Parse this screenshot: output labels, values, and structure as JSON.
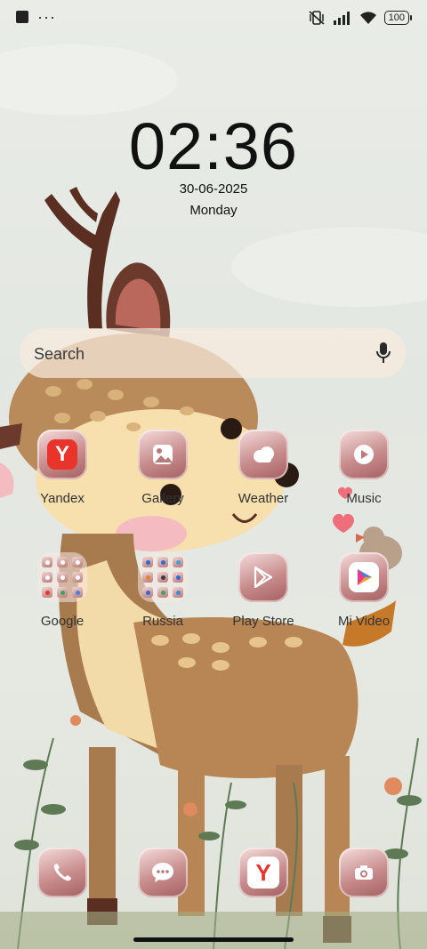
{
  "status_bar": {
    "notification_icon": "square-notification-icon",
    "overflow_text": "···",
    "icons": [
      "vibrate-off-icon",
      "signal-icon",
      "wifi-icon"
    ],
    "battery": "100"
  },
  "lock_clock": {
    "time": "02:36",
    "date": "30-06-2025",
    "day": "Monday"
  },
  "search": {
    "placeholder": "Search",
    "icon": "mic-icon"
  },
  "apps_row1": [
    {
      "label": "Yandex",
      "icon": "yandex-icon"
    },
    {
      "label": "Gallery",
      "icon": "gallery-icon"
    },
    {
      "label": "Weather",
      "icon": "cloud-icon"
    },
    {
      "label": "Music",
      "icon": "play-icon"
    }
  ],
  "apps_row2": [
    {
      "label": "Google",
      "icon": "folder-icon"
    },
    {
      "label": "Russia",
      "icon": "folder-icon"
    },
    {
      "label": "Play Store",
      "icon": "play-store-icon"
    },
    {
      "label": "Mi Video",
      "icon": "mi-video-icon"
    }
  ],
  "dock": [
    {
      "icon": "phone-icon"
    },
    {
      "icon": "messages-icon"
    },
    {
      "icon": "yandex-browser-icon"
    },
    {
      "icon": "camera-icon"
    }
  ],
  "colors": {
    "icon_tile": "#c88c8c",
    "yandex_red": "#e8342b",
    "text": "#111111"
  }
}
